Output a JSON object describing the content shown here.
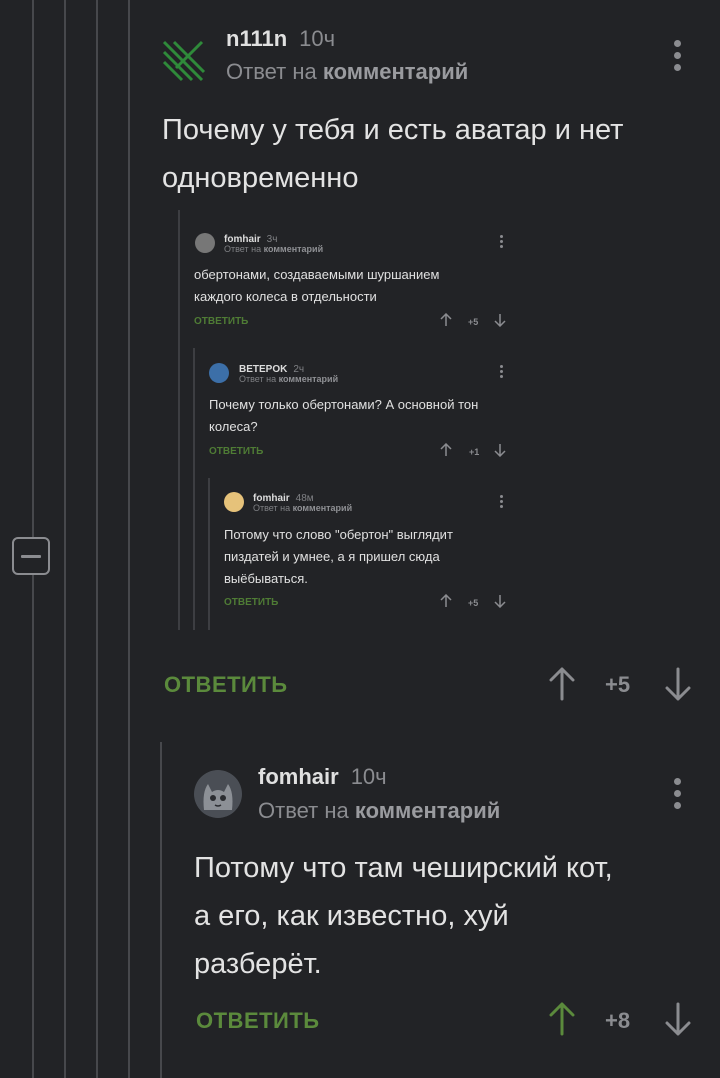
{
  "comments": [
    {
      "nick": "n111n",
      "time": "10ч",
      "reply_prefix": "Ответ на",
      "reply_target": "комментарий",
      "text": "Почему у тебя и есть аватар и нет одновременно",
      "reply_label": "ОТВЕТИТЬ",
      "rating": "+5",
      "avatar_icon": "green-stripes-avatar"
    },
    {
      "nick": "fomhair",
      "time": "10ч",
      "reply_prefix": "Ответ на",
      "reply_target": "комментарий",
      "text": "Потому что там чеширский кот, а его, как известно, хуй разберёт.",
      "reply_label": "ОТВЕТИТЬ",
      "rating": "+8",
      "upvoted": true,
      "avatar_icon": "cat-avatar"
    }
  ],
  "embedded_screenshot": {
    "comments": [
      {
        "nick": "fomhair",
        "time": "3ч",
        "reply_prefix": "Ответ на",
        "reply_target": "комментарий",
        "text": "обертонами, создаваемыми шуршанием каждого колеса в отдельности",
        "reply_label": "ОТВЕТИТЬ",
        "rating": "+5"
      },
      {
        "nick": "BETEPOK",
        "time": "2ч",
        "reply_prefix": "Ответ на",
        "reply_target": "комментарий",
        "text": "Почему только обертонами? А основной тон колеса?",
        "reply_label": "ОТВЕТИТЬ",
        "rating": "+1"
      },
      {
        "nick": "fomhair",
        "time": "48м",
        "reply_prefix": "Ответ на",
        "reply_target": "комментарий",
        "text": "Потому что слово \"обертон\" выглядит пиздатей и умнее, а я пришел сюда выёбываться.",
        "reply_label": "ОТВЕТИТЬ",
        "rating": "+5"
      }
    ]
  },
  "colors": {
    "background": "#222326",
    "reply_green": "#5b8a3c",
    "upvote_active": "#5b8a3c",
    "muted": "#8b8c90"
  }
}
